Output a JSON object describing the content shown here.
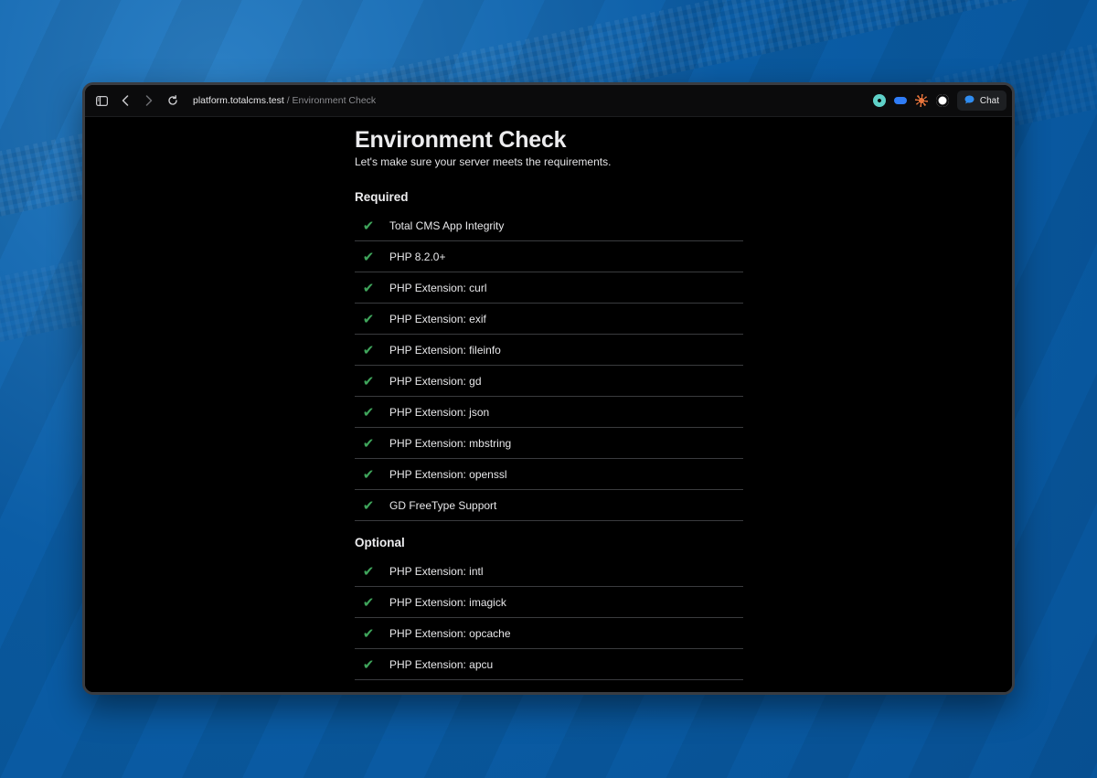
{
  "browser": {
    "url_host": "platform.totalcms.test",
    "url_separator": " / ",
    "page_title": "Environment Check",
    "chat_label": "Chat",
    "icons": [
      "sidebar-toggle-icon",
      "back-icon",
      "forward-icon",
      "reload-icon"
    ],
    "extensions": [
      {
        "name": "extension-teal-icon",
        "color": "#5fd1c8"
      },
      {
        "name": "extension-toggle-icon",
        "color": "#2f7cf6"
      },
      {
        "name": "extension-sun-icon",
        "color": "#e8743b"
      },
      {
        "name": "extension-1password-icon",
        "color": "#ffffff"
      }
    ]
  },
  "page": {
    "title": "Environment Check",
    "subtitle": "Let's make sure your server meets the requirements."
  },
  "required": {
    "heading": "Required",
    "items": [
      {
        "label": "Total CMS App Integrity",
        "status": "pass"
      },
      {
        "label": "PHP 8.2.0+",
        "status": "pass"
      },
      {
        "label": "PHP Extension: curl",
        "status": "pass"
      },
      {
        "label": "PHP Extension: exif",
        "status": "pass"
      },
      {
        "label": "PHP Extension: fileinfo",
        "status": "pass"
      },
      {
        "label": "PHP Extension: gd",
        "status": "pass"
      },
      {
        "label": "PHP Extension: json",
        "status": "pass"
      },
      {
        "label": "PHP Extension: mbstring",
        "status": "pass"
      },
      {
        "label": "PHP Extension: openssl",
        "status": "pass"
      },
      {
        "label": "GD FreeType Support",
        "status": "pass"
      }
    ]
  },
  "optional": {
    "heading": "Optional",
    "items": [
      {
        "label": "PHP Extension: intl",
        "status": "pass"
      },
      {
        "label": "PHP Extension: imagick",
        "status": "pass"
      },
      {
        "label": "PHP Extension: opcache",
        "status": "pass"
      },
      {
        "label": "PHP Extension: apcu",
        "status": "pass"
      }
    ]
  },
  "check_glyph": "✔",
  "colors": {
    "check": "#3fa55b",
    "background": "#000000",
    "desktop": "#0a5fa8"
  }
}
